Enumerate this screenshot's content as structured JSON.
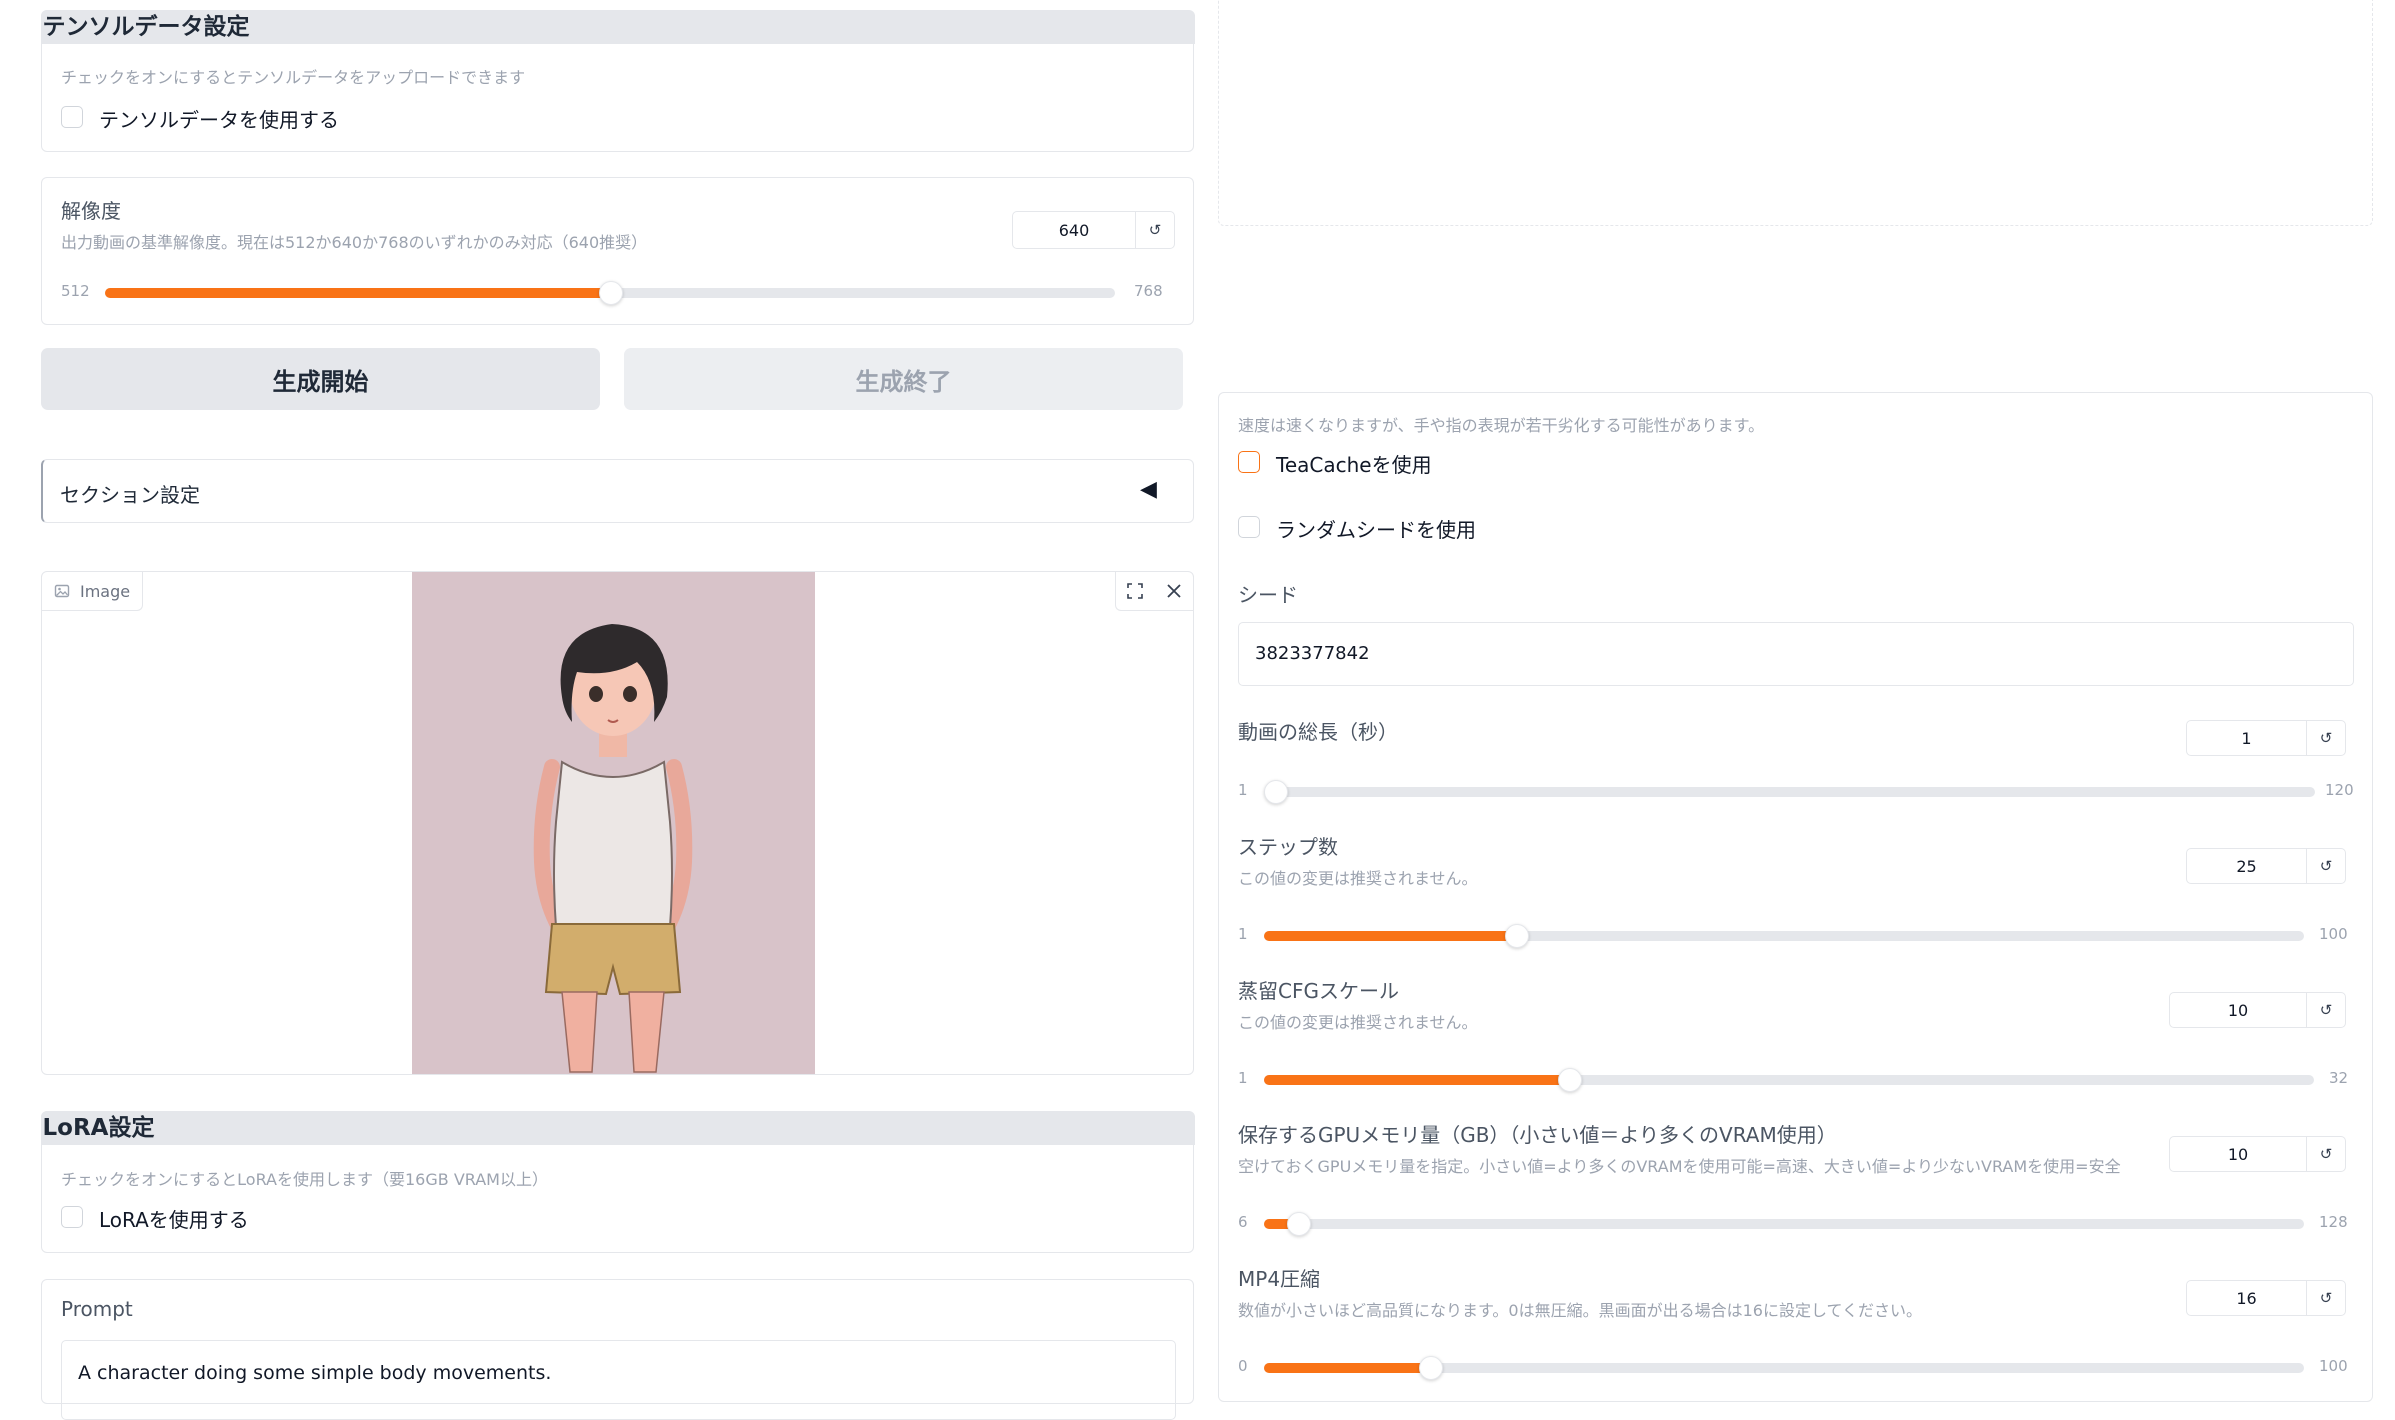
{
  "tensor": {
    "header": "テンソルデータ設定",
    "info": "チェックをオンにするとテンソルデータをアップロードできます",
    "checkbox_label": "テンソルデータを使用する"
  },
  "resolution": {
    "label": "解像度",
    "info": "出力動画の基準解像度。現在は512か640か768のいずれかのみ対応（640推奨）",
    "value": "640",
    "reset": "↺",
    "min": "512",
    "max": "768",
    "fraction": 0.5
  },
  "buttons": {
    "start": "生成開始",
    "end": "生成終了"
  },
  "section": {
    "label": "セクション設定",
    "toggle_icon": "◀"
  },
  "image": {
    "label": "Image"
  },
  "lora": {
    "header": "LoRA設定",
    "info": "チェックをオンにするとLoRAを使用します（要16GB VRAM以上）",
    "checkbox_label": "LoRAを使用する"
  },
  "prompt": {
    "label": "Prompt",
    "value": "A character doing some simple body movements."
  },
  "teacache": {
    "info": "速度は速くなりますが、手や指の表現が若干劣化する可能性があります。",
    "label": "TeaCacheを使用"
  },
  "random_seed": {
    "label": "ランダムシードを使用"
  },
  "seed": {
    "label": "シード",
    "value": "3823377842"
  },
  "sliders": [
    {
      "label": "動画の総長（秒）",
      "info": "",
      "value": "1",
      "reset": "↺",
      "min": "1",
      "max": "120",
      "fraction": 0.0
    },
    {
      "label": "ステップ数",
      "info": "この値の変更は推奨されません。",
      "value": "25",
      "reset": "↺",
      "min": "1",
      "max": "100",
      "fraction": 0.2424
    },
    {
      "label": "蒸留CFGスケール",
      "info": "この値の変更は推奨されません。",
      "value": "10",
      "reset": "↺",
      "min": "1",
      "max": "32",
      "fraction": 0.2903
    },
    {
      "label": "保存するGPUメモリ量（GB）（小さい値＝より多くのVRAM使用）",
      "info": "空けておくGPUメモリ量を指定。小さい値=より多くのVRAMを使用可能=高速、大きい値=より少ないVRAMを使用=安全",
      "value": "10",
      "reset": "↺",
      "min": "6",
      "max": "128",
      "fraction": 0.0328
    },
    {
      "label": "MP4圧縮",
      "info": "数値が小さいほど高品質になります。0は無圧縮。黒画面が出る場合は16に設定してください。",
      "value": "16",
      "reset": "↺",
      "min": "0",
      "max": "100",
      "fraction": 0.16
    }
  ],
  "colors": {
    "accent": "#f97316",
    "border": "#e5e7eb",
    "header_bg": "#e5e7eb",
    "muted_text": "#9ca3af"
  }
}
